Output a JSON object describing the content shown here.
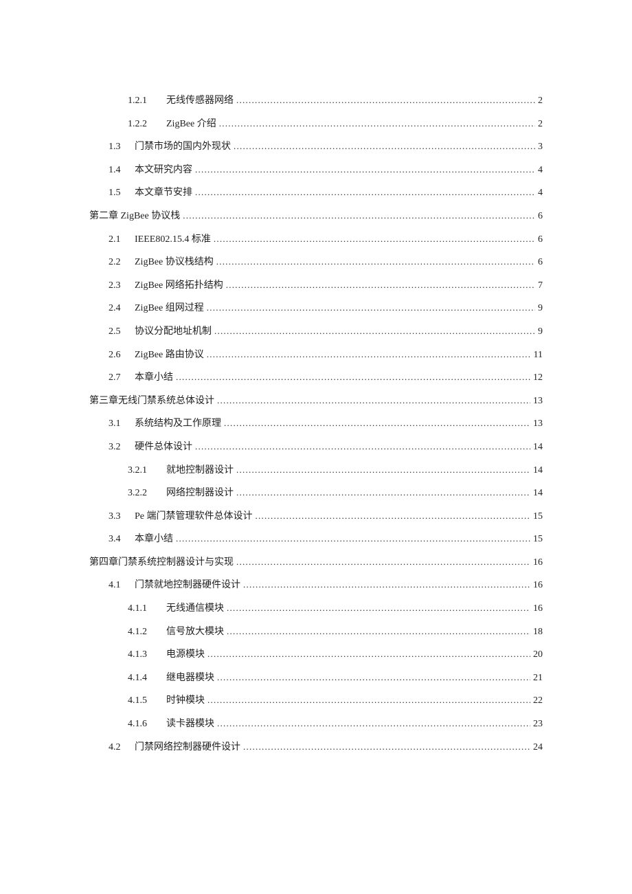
{
  "toc": [
    {
      "level": 2,
      "num": "1.2.1",
      "label": "无线传感器网络",
      "page": "2"
    },
    {
      "level": 2,
      "num": "1.2.2",
      "label": "ZigBee 介绍",
      "page": "2"
    },
    {
      "level": 1,
      "num": "1.3",
      "label": "门禁市场的国内外现状",
      "page": "3"
    },
    {
      "level": 1,
      "num": "1.4",
      "label": "本文研究内容",
      "page": "4"
    },
    {
      "level": 1,
      "num": "1.5",
      "label": "本文章节安排",
      "page": "4"
    },
    {
      "level": 0,
      "num": "",
      "label": "第二章 ZigBee 协议栈",
      "page": "6"
    },
    {
      "level": 1,
      "num": "2.1",
      "label": "IEEE802.15.4 标准",
      "page": "6"
    },
    {
      "level": 1,
      "num": "2.2",
      "label": "ZigBee 协议栈结构",
      "page": "6"
    },
    {
      "level": 1,
      "num": "2.3",
      "label": "ZigBee 网络拓扑结构",
      "page": "7"
    },
    {
      "level": 1,
      "num": "2.4",
      "label": "ZigBee 组网过程",
      "page": "9"
    },
    {
      "level": 1,
      "num": "2.5",
      "label": "协议分配地址机制",
      "page": "9"
    },
    {
      "level": 1,
      "num": "2.6",
      "label": "ZigBee 路由协议",
      "page": "11"
    },
    {
      "level": 1,
      "num": "2.7",
      "label": "本章小结",
      "page": "12"
    },
    {
      "level": 0,
      "num": "",
      "label": "第三章无线门禁系统总体设计",
      "page": "13"
    },
    {
      "level": 1,
      "num": "3.1",
      "label": "系统结构及工作原理",
      "page": "13"
    },
    {
      "level": 1,
      "num": "3.2",
      "label": "硬件总体设计",
      "page": "14"
    },
    {
      "level": 2,
      "num": "3.2.1",
      "label": "就地控制器设计",
      "page": "14"
    },
    {
      "level": 2,
      "num": "3.2.2",
      "label": "网络控制器设计",
      "page": "14"
    },
    {
      "level": 1,
      "num": "3.3",
      "label": "Pe 端门禁管理软件总体设计",
      "page": "15"
    },
    {
      "level": 1,
      "num": "3.4",
      "label": "本章小结",
      "page": "15"
    },
    {
      "level": 0,
      "num": "",
      "label": "第四章门禁系统控制器设计与实现",
      "page": "16"
    },
    {
      "level": 1,
      "num": "4.1",
      "label": "门禁就地控制器硬件设计",
      "page": "16"
    },
    {
      "level": 2,
      "num": "4.1.1",
      "label": "无线通信模块",
      "page": "16"
    },
    {
      "level": 2,
      "num": "4.1.2",
      "label": "信号放大模块",
      "page": "18"
    },
    {
      "level": 2,
      "num": "4.1.3",
      "label": "电源模块",
      "page": "20"
    },
    {
      "level": 2,
      "num": "4.1.4",
      "label": "继电器模块",
      "page": "21"
    },
    {
      "level": 2,
      "num": "4.1.5",
      "label": "时钟模块",
      "page": "22"
    },
    {
      "level": 2,
      "num": "4.1.6",
      "label": "读卡器模块",
      "page": "23"
    },
    {
      "level": 1,
      "num": "4.2",
      "label": "门禁网络控制器硬件设计",
      "page": "24"
    }
  ]
}
